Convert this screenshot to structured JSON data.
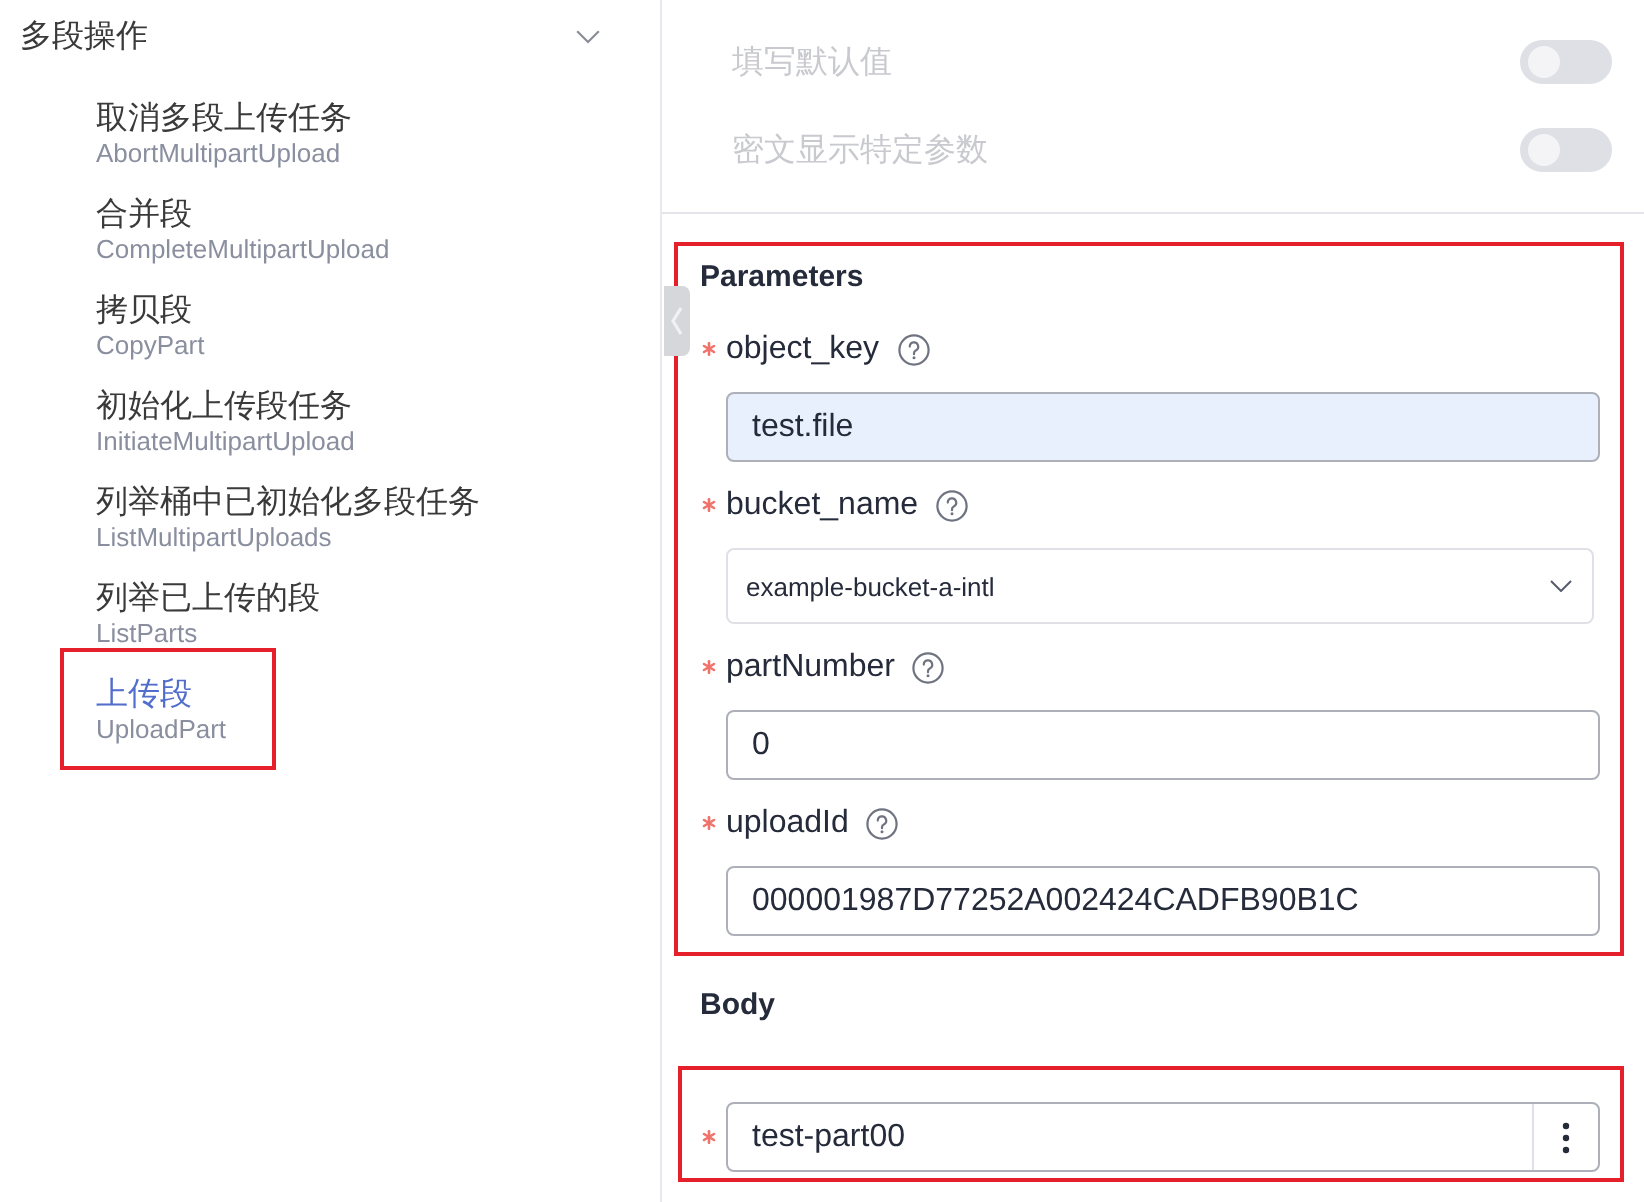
{
  "sidebar": {
    "group": {
      "title": "多段操作",
      "expanded": true
    },
    "items": [
      {
        "title": "取消多段上传任务",
        "subtitle": "AbortMultipartUpload",
        "selected": false,
        "highlighted": false
      },
      {
        "title": "合并段",
        "subtitle": "CompleteMultipartUpload",
        "selected": false,
        "highlighted": false
      },
      {
        "title": "拷贝段",
        "subtitle": "CopyPart",
        "selected": false,
        "highlighted": false
      },
      {
        "title": "初始化上传段任务",
        "subtitle": "InitiateMultipartUpload",
        "selected": false,
        "highlighted": false
      },
      {
        "title": "列举桶中已初始化多段任务",
        "subtitle": "ListMultipartUploads",
        "selected": false,
        "highlighted": false
      },
      {
        "title": "列举已上传的段",
        "subtitle": "ListParts",
        "selected": false,
        "highlighted": false
      },
      {
        "title": "上传段",
        "subtitle": "UploadPart",
        "selected": true,
        "highlighted": true
      }
    ]
  },
  "settings": [
    {
      "label": "填写默认值",
      "on": false,
      "disabled": true
    },
    {
      "label": "密文显示特定参数",
      "on": false,
      "disabled": true
    }
  ],
  "parameters": {
    "title": "Parameters",
    "highlighted": true,
    "fields": [
      {
        "label": "object_key",
        "required": true,
        "help": true,
        "kind": "input",
        "value": "test.file",
        "autofilled": true
      },
      {
        "label": "bucket_name",
        "required": true,
        "help": true,
        "kind": "select",
        "value": "example-bucket-a-intl"
      },
      {
        "label": "partNumber",
        "required": true,
        "help": true,
        "kind": "input",
        "value": "0",
        "autofilled": false
      },
      {
        "label": "uploadId",
        "required": true,
        "help": true,
        "kind": "input",
        "value": "000001987D77252A002424CADFB90B1C",
        "autofilled": false
      }
    ]
  },
  "body": {
    "title": "Body",
    "highlighted": true,
    "field": {
      "required": true,
      "value": "test-part00"
    }
  }
}
